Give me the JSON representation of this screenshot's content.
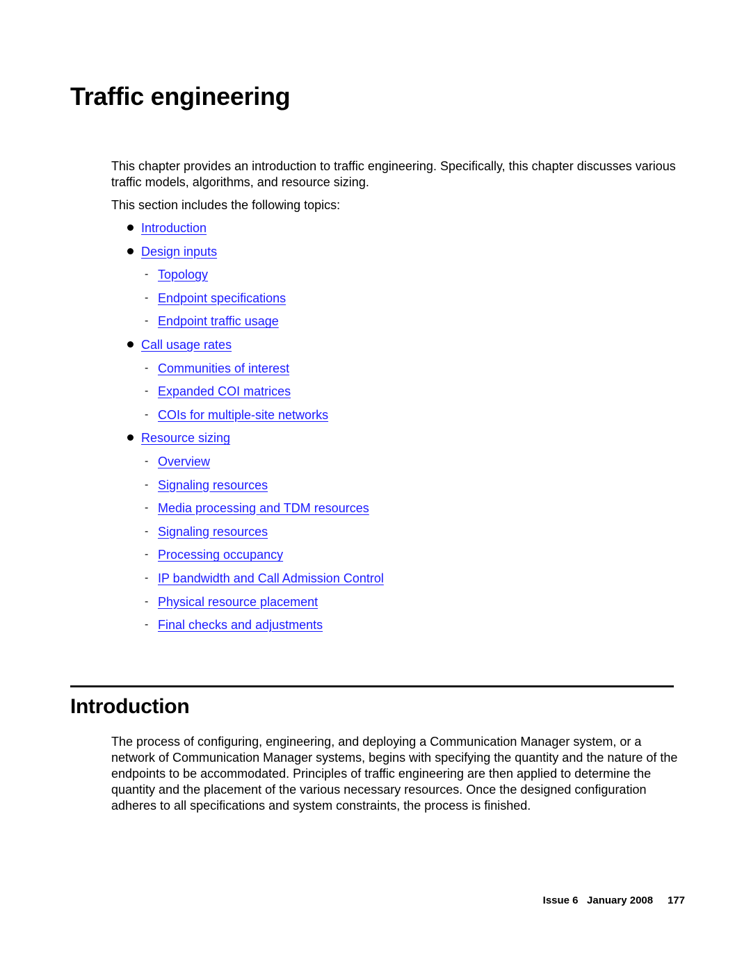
{
  "page": {
    "title": "Traffic engineering",
    "intro_paragraph": "This chapter provides an introduction to traffic engineering. Specifically, this chapter discusses various traffic models, algorithms, and resource sizing.",
    "topics_lead": "This section includes the following topics:",
    "toc": [
      {
        "level": 1,
        "label": "Introduction"
      },
      {
        "level": 1,
        "label": "Design inputs"
      },
      {
        "level": 2,
        "label": "Topology"
      },
      {
        "level": 2,
        "label": "Endpoint specifications"
      },
      {
        "level": 2,
        "label": "Endpoint traffic usage"
      },
      {
        "level": 1,
        "label": "Call usage rates"
      },
      {
        "level": 2,
        "label": "Communities of interest"
      },
      {
        "level": 2,
        "label": "Expanded COI matrices"
      },
      {
        "level": 2,
        "label": "COIs for multiple-site networks"
      },
      {
        "level": 1,
        "label": "Resource sizing"
      },
      {
        "level": 2,
        "label": "Overview"
      },
      {
        "level": 2,
        "label": "Signaling resources"
      },
      {
        "level": 2,
        "label": "Media processing and TDM resources"
      },
      {
        "level": 2,
        "label": "Signaling resources"
      },
      {
        "level": 2,
        "label": "Processing occupancy"
      },
      {
        "level": 2,
        "label": "IP bandwidth and Call Admission Control"
      },
      {
        "level": 2,
        "label": "Physical resource placement"
      },
      {
        "level": 2,
        "label": "Final checks and adjustments"
      }
    ],
    "section": {
      "heading": "Introduction",
      "paragraph": "The process of configuring, engineering, and deploying a Communication Manager system, or a network of Communication Manager systems, begins with specifying the quantity and the nature of the endpoints to be accommodated. Principles of traffic engineering are then applied to determine the quantity and the placement of the various necessary resources. Once the designed configuration adheres to all specifications and system constraints, the process is finished."
    },
    "footer": {
      "issue": "Issue 6",
      "date": "January 2008",
      "page_number": "177"
    },
    "colors": {
      "link": "#1a1aff",
      "text": "#000000"
    }
  }
}
